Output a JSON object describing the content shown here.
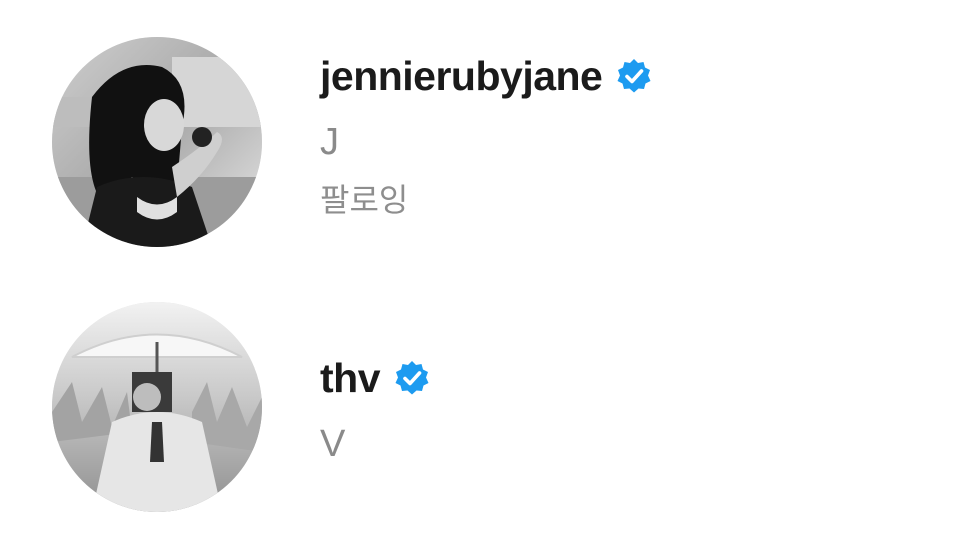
{
  "accounts": [
    {
      "username": "jennierubyjane",
      "verified": true,
      "verified_icon": "verified-badge-icon",
      "full_name": "J",
      "follow_status": "팔로잉"
    },
    {
      "username": "thv",
      "verified": true,
      "verified_icon": "verified-badge-icon",
      "full_name": "V"
    }
  ],
  "colors": {
    "verified_blue": "#1d9bf0",
    "username_text": "#1b1b1b",
    "secondary_text": "#8a8a8a"
  }
}
